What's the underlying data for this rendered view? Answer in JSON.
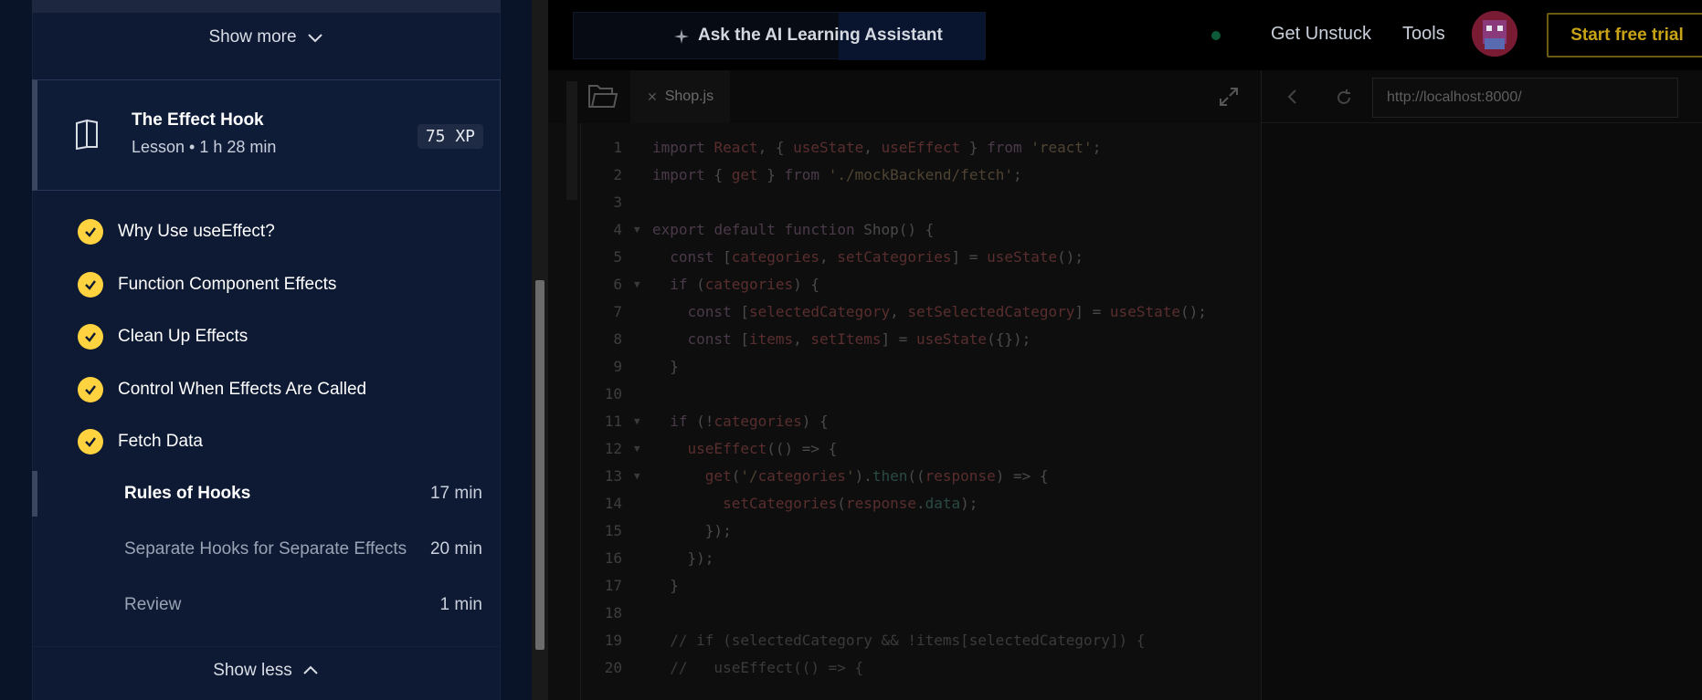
{
  "sidebar": {
    "show_more_label": "Show more",
    "show_less_label": "Show less",
    "lesson": {
      "title": "The Effect Hook",
      "meta": "Lesson • 1 h 28 min",
      "xp": "75 XP"
    },
    "completed_items": [
      "Why Use useEffect?",
      "Function Component Effects",
      "Clean Up Effects",
      "Control When Effects Are Called",
      "Fetch Data"
    ],
    "pending_items": [
      {
        "label": "Rules of Hooks",
        "duration": "17 min",
        "current": true
      },
      {
        "label": "Separate Hooks for Separate Effects",
        "duration": "20 min",
        "current": false
      },
      {
        "label": "Review",
        "duration": "1 min",
        "current": false
      }
    ]
  },
  "header": {
    "ai_assistant_label": "Ask the AI Learning Assistant",
    "get_unstuck_label": "Get Unstuck",
    "tools_label": "Tools",
    "trial_button_label": "Start free trial"
  },
  "editor": {
    "tab_name": "Shop.js",
    "lines": [
      "import React, { useState, useEffect } from 'react';",
      "import { get } from './mockBackend/fetch';",
      "",
      "export default function Shop() {",
      "  const [categories, setCategories] = useState();",
      "  if (categories) {",
      "    const [selectedCategory, setSelectedCategory] = useState();",
      "    const [items, setItems] = useState({});",
      "  }",
      "",
      "  if (!categories) {",
      "    useEffect(() => {",
      "      get('/categories').then((response) => {",
      "        setCategories(response.data);",
      "      });",
      "    });",
      "  }",
      "",
      "  // if (selectedCategory && !items[selectedCategory]) {",
      "  //   useEffect(() => {"
    ],
    "line_numbers": [
      "1",
      "2",
      "3",
      "4",
      "5",
      "6",
      "7",
      "8",
      "9",
      "10",
      "11",
      "12",
      "13",
      "14",
      "15",
      "16",
      "17",
      "18",
      "19",
      "20"
    ],
    "fold_markers": [
      "4",
      "6",
      "11",
      "12",
      "13"
    ]
  },
  "preview": {
    "url": "http://localhost:8000/"
  },
  "colors": {
    "accent_yellow": "#ffd23f",
    "sidebar_bg": "#0e1a33",
    "trial_border": "#6b5a12"
  },
  "icons": {
    "show_more": "chevron-down-icon",
    "show_less": "chevron-up-icon",
    "lesson": "book-icon",
    "completed": "check-icon",
    "ai": "sparkle-icon",
    "folder": "folder-icon",
    "expand": "expand-icon",
    "back": "chevron-left-icon",
    "reload": "reload-icon"
  }
}
